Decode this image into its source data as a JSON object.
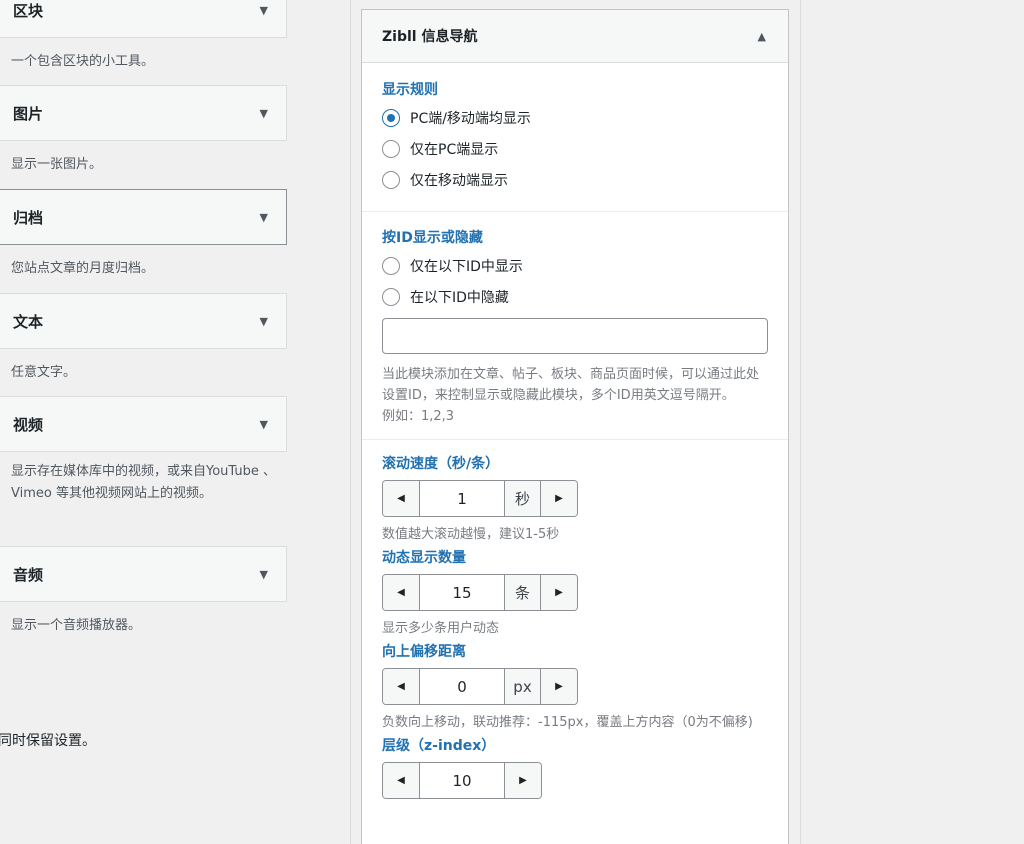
{
  "widgets": [
    {
      "title": "区块",
      "desc": "一个包含区块的小工具。"
    },
    {
      "title": "图片",
      "desc": "显示一张图片。"
    },
    {
      "title": "归档",
      "desc": "您站点文章的月度归档。"
    },
    {
      "title": "文本",
      "desc": "任意文字。"
    },
    {
      "title": "视频",
      "desc": "显示存在媒体库中的视频，或来自YouTube 、 Vimeo 等其他视频网站上的视频。"
    },
    {
      "title": "音频",
      "desc": "显示一个音频播放器。"
    }
  ],
  "footer_note": "同时保留设置。",
  "panel": {
    "title": "Zibll 信息导航",
    "display_rule": {
      "title": "显示规则",
      "options": [
        "PC端/移动端均显示",
        "仅在PC端显示",
        "仅在移动端显示"
      ],
      "selected_index": 0
    },
    "id_rule": {
      "title": "按ID显示或隐藏",
      "options": [
        "仅在以下ID中显示",
        "在以下ID中隐藏"
      ],
      "input_value": "",
      "help": "当此模块添加在文章、帖子、板块、商品页面时候，可以通过此处设置ID，来控制显示或隐藏此模块，多个ID用英文逗号隔开。",
      "example": "例如：1,2,3"
    },
    "scroll_speed": {
      "title": "滚动速度（秒/条）",
      "value": "1",
      "unit": "秒",
      "help": "数值越大滚动越慢，建议1-5秒"
    },
    "count": {
      "title": "动态显示数量",
      "value": "15",
      "unit": "条",
      "help": "显示多少条用户动态"
    },
    "offset": {
      "title": "向上偏移距离",
      "value": "0",
      "unit": "px",
      "help": "负数向上移动，联动推荐：-115px，覆盖上方内容（0为不偏移)"
    },
    "zindex": {
      "title": "层级（z-index）",
      "value": "10"
    }
  },
  "icons": {
    "collapse": "caret-down-icon",
    "expand": "caret-up-icon",
    "decrement": "caret-left-icon",
    "increment": "caret-right-icon"
  },
  "colors": {
    "accent": "#2271b1",
    "panel_bg": "#ffffff",
    "page_bg": "#f0f0f1"
  }
}
